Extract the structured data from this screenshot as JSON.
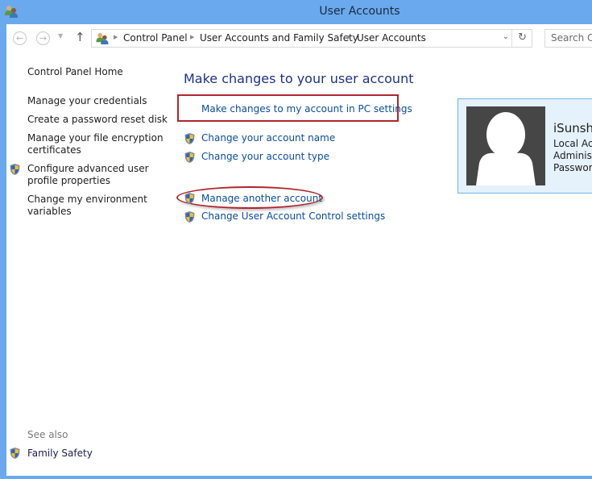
{
  "window": {
    "title": "User Accounts",
    "title_icon": "user-accounts-icon",
    "border_color": "#6aa9ee"
  },
  "navigation": {
    "back_icon": "←",
    "forward_icon": "→",
    "recent_icon": "▼",
    "up_icon": "↑",
    "breadcrumb": [
      "Control Panel",
      "User Accounts and Family Safety",
      "User Accounts"
    ],
    "separator": "▶",
    "dropdown_icon": "⌄",
    "refresh_icon": "↻",
    "search_placeholder": "Search Control Panel",
    "search_visible_text": "Search Co"
  },
  "sidebar": {
    "home_link": "Control Panel Home",
    "links": [
      {
        "label": "Manage your credentials",
        "shield": false
      },
      {
        "label": "Create a password reset disk",
        "shield": false
      },
      {
        "label": "Manage your file encryption certificates",
        "line1": "Manage your file encryption",
        "line2": "certificates",
        "shield": false
      },
      {
        "label": "Configure advanced user profile properties",
        "line1": "Configure advanced user",
        "line2": "profile properties",
        "shield": true
      },
      {
        "label": "Change my environment variables",
        "line1": "Change my environment",
        "line2": "variables",
        "shield": false
      }
    ],
    "see_also_label": "See also",
    "see_also_links": [
      {
        "label": "Family Safety",
        "shield": true
      }
    ]
  },
  "main": {
    "heading": "Make changes to your user account",
    "tasks": [
      {
        "label": "Make changes to my account in PC settings",
        "shield": false,
        "highlight": "rectangle"
      },
      {
        "label": "Change your account name",
        "shield": true
      },
      {
        "label": "Change your account type",
        "shield": true
      },
      {
        "label": "Manage another account",
        "shield": true,
        "highlight": "oval"
      },
      {
        "label": "Change User Account Control settings",
        "shield": true
      }
    ],
    "highlight_color": "#b0262c",
    "link_color": "#0a4ea0"
  },
  "profile": {
    "name": "iSunshare",
    "name_visible": "iSunsh",
    "account_type": "Local Acc",
    "role": "Administ",
    "password": "Password",
    "avatar_icon": "default-user-avatar"
  }
}
